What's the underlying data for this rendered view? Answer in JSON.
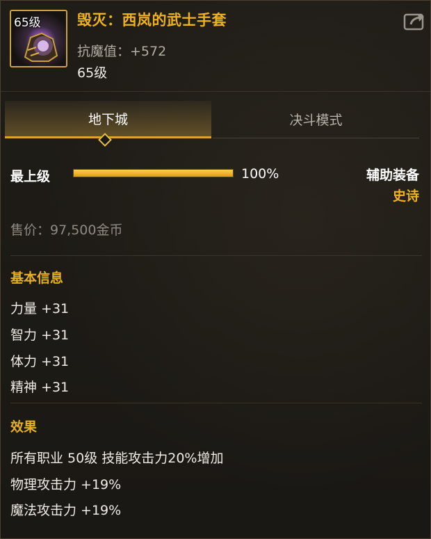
{
  "item": {
    "icon_level": "65级",
    "name": "毁灭：西岚的武士手套",
    "resist": "抗魔值：+572",
    "level": "65级",
    "icon": "gauntlet-icon"
  },
  "header": {
    "share_icon": "share-external-icon"
  },
  "tabs": [
    {
      "label": "地下城",
      "active": true
    },
    {
      "label": "决斗模式",
      "active": false
    }
  ],
  "grade": {
    "label": "最上级",
    "progress": 1.0,
    "percent_text": "100%"
  },
  "equip": {
    "type": "辅助装备",
    "rarity": "史诗"
  },
  "price": "售价：97,500金币",
  "basic_info": {
    "title": "基本信息",
    "stats": [
      "力量 +31",
      "智力 +31",
      "体力 +31",
      "精神 +31"
    ]
  },
  "effects": {
    "title": "效果",
    "lines": [
      "所有职业 50级 技能攻击力20%增加",
      "物理攻击力 +19%",
      "魔法攻击力 +19%"
    ]
  },
  "colors": {
    "gold": "#f0b21d",
    "accent": "#d8a72a",
    "background": "#1c1914"
  }
}
